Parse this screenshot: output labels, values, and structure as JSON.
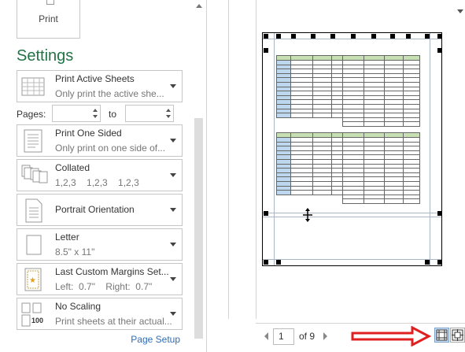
{
  "print": {
    "label": "Print"
  },
  "settings": {
    "title": "Settings",
    "active_sheets": {
      "title": "Print Active Sheets",
      "sub": "Only print the active she..."
    },
    "pages": {
      "label": "Pages:",
      "to": "to",
      "from_value": "",
      "to_value": ""
    },
    "sided": {
      "title": "Print One Sided",
      "sub": "Only print on one side of..."
    },
    "collated": {
      "title": "Collated",
      "sub": "1,2,3    1,2,3    1,2,3"
    },
    "orientation": {
      "title": "Portrait Orientation"
    },
    "paper": {
      "title": "Letter",
      "sub": "8.5\" x 11\""
    },
    "margins": {
      "title": "Last Custom Margins Set...",
      "sub": "Left:  0.7\"    Right:  0.7\""
    },
    "scaling": {
      "title": "No Scaling",
      "sub": "Print sheets at their actual...",
      "icon_text": "100"
    },
    "page_setup": "Page Setup"
  },
  "preview": {
    "current_page": "1",
    "of_pages": "of 9",
    "rows_per_table": 13
  },
  "colors": {
    "accent_green": "#217346",
    "header_green": "#c6e0b4",
    "id_blue": "#bdd7ee",
    "link_blue": "#2e6db5",
    "arrow_red": "#e02020"
  },
  "icons": {
    "no_margins": "show-margins-icon",
    "zoom_page": "zoom-to-page-icon"
  }
}
